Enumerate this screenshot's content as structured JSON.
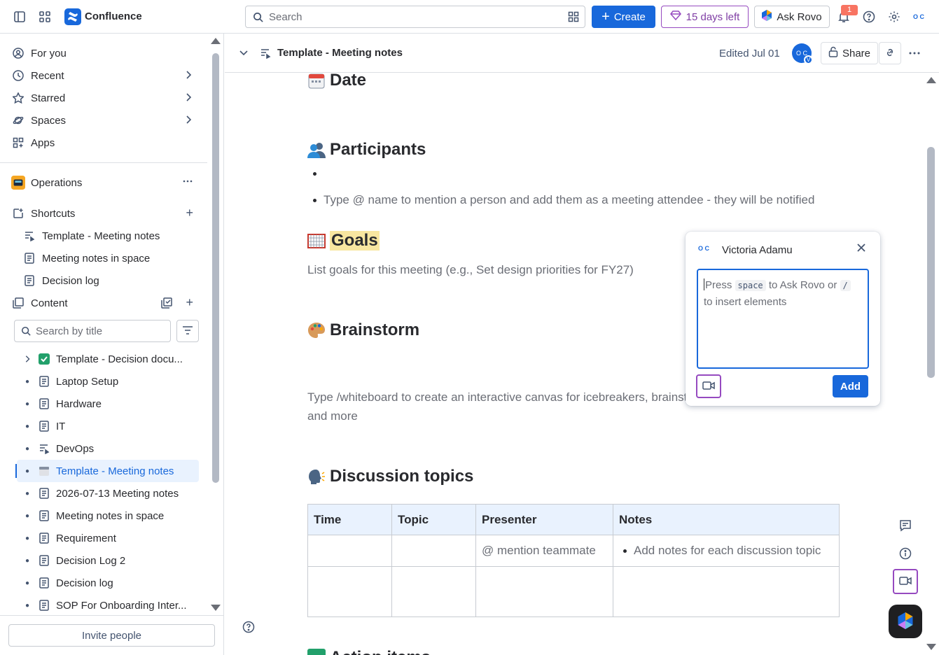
{
  "topbar": {
    "app_name": "Confluence",
    "search_placeholder": "Search",
    "create_label": "Create",
    "trial_label": "15 days left",
    "rovo_label": "Ask Rovo",
    "notification_count": "1",
    "avatar_initials": "O C"
  },
  "sidebar": {
    "nav": [
      {
        "label": "For you"
      },
      {
        "label": "Recent"
      },
      {
        "label": "Starred"
      },
      {
        "label": "Spaces"
      },
      {
        "label": "Apps"
      }
    ],
    "space_name": "Operations",
    "shortcuts_label": "Shortcuts",
    "shortcuts": [
      {
        "label": "Template - Meeting notes"
      },
      {
        "label": "Meeting notes in space"
      },
      {
        "label": "Decision log"
      }
    ],
    "content_label": "Content",
    "filter_placeholder": "Search by title",
    "tree": [
      {
        "label": "Template - Decision docu..."
      },
      {
        "label": "Laptop Setup"
      },
      {
        "label": "Hardware"
      },
      {
        "label": "IT"
      },
      {
        "label": "DevOps"
      },
      {
        "label": "Template - Meeting notes"
      },
      {
        "label": "2026-07-13 Meeting notes"
      },
      {
        "label": "Meeting notes in space"
      },
      {
        "label": "Requirement"
      },
      {
        "label": "Decision Log 2"
      },
      {
        "label": "Decision log"
      },
      {
        "label": "SOP For Onboarding Inter..."
      }
    ],
    "invite_label": "Invite people"
  },
  "page_header": {
    "title": "Template - Meeting notes",
    "edited": "Edited Jul 01",
    "avatar_initials": "O C",
    "avatar_badge": "V",
    "share_label": "Share"
  },
  "doc": {
    "date_heading": "Date",
    "participants_heading": "Participants",
    "participants_hint": "Type @ name to mention a person and add them as a meeting attendee - they will be notified",
    "goals_heading": "Goals",
    "goals_hint": "List goals for this meeting (e.g., Set design priorities for FY27)",
    "brainstorm_heading": "Brainstorm",
    "brainstorm_hint_1": "Type /whiteboard to create an interactive canvas for icebreakers, brainst",
    "brainstorm_hint_2": "and more",
    "discussion_heading": "Discussion topics",
    "table_headers": [
      "Time",
      "Topic",
      "Presenter",
      "Notes"
    ],
    "row1_presenter": "@ mention teammate",
    "row1_notes": "Add notes for each discussion topic",
    "next_heading_partial": "Action items"
  },
  "comment_popup": {
    "author": "Victoria Adamu",
    "placeholder_pre": "Press",
    "key_space": "space",
    "placeholder_mid": "to Ask Rovo or",
    "key_slash": "/",
    "placeholder_post": "to insert elements",
    "add_label": "Add"
  },
  "colors": {
    "brand": "#1868db",
    "trial": "#964ac0",
    "highlight": "#f8e6a0"
  }
}
